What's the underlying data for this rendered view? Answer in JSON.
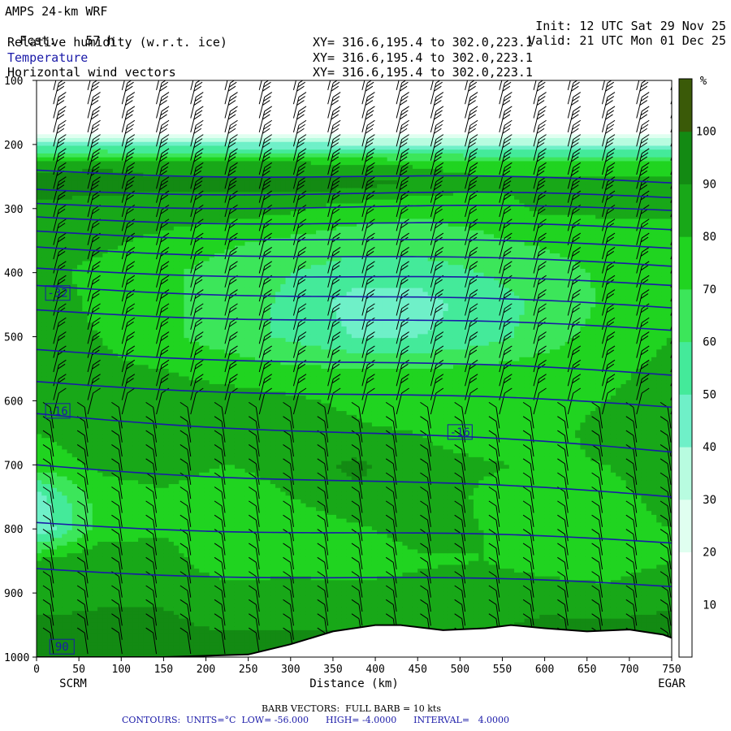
{
  "header": {
    "model": "AMPS 24-km WRF",
    "fcst_label": "Fcst:",
    "fcst_value": "57 h",
    "init_label": "Init:",
    "init_value": "12 UTC Sat 29 Nov 25",
    "valid_label": "Valid:",
    "valid_value": "21 UTC Mon 01 Dec 25",
    "fields": [
      {
        "name": "Relative humidity (w.r.t. ice)",
        "xy": "XY= 316.6,195.4 to 302.0,223.1",
        "color": "#000000"
      },
      {
        "name": "Temperature",
        "xy": "XY= 316.6,195.4 to 302.0,223.1",
        "color": "#1a1aa8"
      },
      {
        "name": "Horizontal wind vectors",
        "xy": "XY= 316.6,195.4 to 302.0,223.1",
        "color": "#000000"
      }
    ]
  },
  "chart_data": {
    "type": "heatmap",
    "xlabel": "Distance (km)",
    "ylabel": "Pressure (hPa)",
    "xlim": [
      0,
      750
    ],
    "ylim": [
      1000,
      100
    ],
    "x_ticks": [
      0,
      50,
      100,
      150,
      200,
      250,
      300,
      350,
      400,
      450,
      500,
      550,
      600,
      650,
      700,
      750
    ],
    "y_ticks": [
      100,
      200,
      300,
      400,
      500,
      600,
      700,
      800,
      900,
      1000
    ],
    "start_point": "SCRM",
    "end_point": "EGAR",
    "colorbar": {
      "unit": "%",
      "levels": [
        10,
        20,
        30,
        40,
        50,
        60,
        70,
        80,
        90,
        100
      ],
      "colors": [
        "#ffffff",
        "#ffffff",
        "#e0fff0",
        "#b8fce0",
        "#6ff0c8",
        "#44ea9a",
        "#3ce65a",
        "#20d420",
        "#18a818",
        "#138a13",
        "#3a5a08"
      ]
    },
    "rh_field": {
      "x": [
        0,
        75,
        150,
        225,
        300,
        375,
        450,
        525,
        600,
        675,
        750
      ],
      "p": [
        100,
        180,
        230,
        260,
        300,
        350,
        400,
        450,
        500,
        550,
        600,
        650,
        700,
        750,
        800,
        850,
        900,
        950,
        1000
      ],
      "values": [
        [
          5,
          5,
          5,
          5,
          5,
          5,
          5,
          5,
          5,
          5,
          5
        ],
        [
          15,
          15,
          15,
          15,
          15,
          15,
          15,
          15,
          15,
          15,
          15
        ],
        [
          85,
          88,
          85,
          85,
          82,
          80,
          78,
          75,
          75,
          75,
          75
        ],
        [
          95,
          95,
          92,
          92,
          95,
          95,
          88,
          82,
          82,
          82,
          82
        ],
        [
          88,
          85,
          85,
          85,
          82,
          75,
          72,
          75,
          82,
          82,
          82
        ],
        [
          82,
          82,
          78,
          72,
          68,
          65,
          65,
          68,
          72,
          75,
          75
        ],
        [
          82,
          78,
          72,
          65,
          60,
          55,
          55,
          60,
          65,
          72,
          75
        ],
        [
          85,
          78,
          72,
          65,
          58,
          45,
          45,
          55,
          62,
          72,
          78
        ],
        [
          85,
          80,
          72,
          65,
          58,
          50,
          50,
          55,
          65,
          75,
          80
        ],
        [
          85,
          82,
          80,
          75,
          72,
          70,
          70,
          72,
          75,
          78,
          82
        ],
        [
          85,
          85,
          85,
          85,
          82,
          78,
          72,
          72,
          75,
          80,
          85
        ],
        [
          80,
          85,
          88,
          88,
          85,
          82,
          80,
          72,
          75,
          85,
          88
        ],
        [
          75,
          82,
          85,
          80,
          85,
          92,
          85,
          82,
          78,
          80,
          85
        ],
        [
          45,
          75,
          78,
          72,
          80,
          88,
          90,
          78,
          72,
          78,
          82
        ],
        [
          40,
          75,
          78,
          72,
          72,
          78,
          85,
          80,
          75,
          78,
          80
        ],
        [
          82,
          88,
          85,
          72,
          75,
          72,
          78,
          80,
          75,
          75,
          80
        ],
        [
          85,
          88,
          88,
          85,
          85,
          85,
          85,
          88,
          85,
          82,
          88
        ],
        [
          92,
          92,
          92,
          88,
          88,
          88,
          88,
          88,
          92,
          92,
          92
        ],
        [
          98,
          98,
          98,
          98,
          98,
          98,
          98,
          98,
          98,
          98,
          98
        ]
      ]
    },
    "terrain_p": [
      {
        "x": 0,
        "p": 1000
      },
      {
        "x": 150,
        "p": 1000
      },
      {
        "x": 250,
        "p": 996
      },
      {
        "x": 300,
        "p": 980
      },
      {
        "x": 350,
        "p": 960
      },
      {
        "x": 400,
        "p": 950
      },
      {
        "x": 430,
        "p": 950
      },
      {
        "x": 480,
        "p": 958
      },
      {
        "x": 530,
        "p": 955
      },
      {
        "x": 560,
        "p": 950
      },
      {
        "x": 600,
        "p": 955
      },
      {
        "x": 650,
        "p": 960
      },
      {
        "x": 700,
        "p": 957
      },
      {
        "x": 740,
        "p": 965
      },
      {
        "x": 750,
        "p": 970
      }
    ],
    "temperature_contours": [
      {
        "p0": 240,
        "p1": 260
      },
      {
        "p0": 270,
        "p1": 283
      },
      {
        "p0": 292,
        "p1": 303
      },
      {
        "p0": 313,
        "p1": 333
      },
      {
        "p0": 335,
        "p1": 362
      },
      {
        "p0": 360,
        "p1": 390
      },
      {
        "p0": 393,
        "p1": 420
      },
      {
        "p0": 420,
        "p1": 455
      },
      {
        "p0": 458,
        "p1": 490
      },
      {
        "p0": 520,
        "p1": 560
      },
      {
        "p0": 570,
        "p1": 610
      },
      {
        "p0": 620,
        "p1": 680
      },
      {
        "p0": 700,
        "p1": 750
      },
      {
        "p0": 790,
        "p1": 822
      },
      {
        "p0": 862,
        "p1": 890
      }
    ],
    "contour_labels": [
      {
        "text": "-32",
        "x": 25,
        "p": 433
      },
      {
        "text": "-16",
        "x": 25,
        "p": 617
      },
      {
        "text": "-16",
        "x": 500,
        "p": 650
      },
      {
        "text": "90",
        "x": 30,
        "p": 985
      }
    ],
    "footer": {
      "barb_text": "BARB VECTORS:  FULL BARB = 10 kts",
      "contours_text": "CONTOURS:  UNITS=°C  LOW= -56.000      HIGH= -4.0000      INTERVAL=   4.0000"
    },
    "colors": {
      "temperature": "#1a1aa8",
      "barbs": "#000000"
    }
  }
}
